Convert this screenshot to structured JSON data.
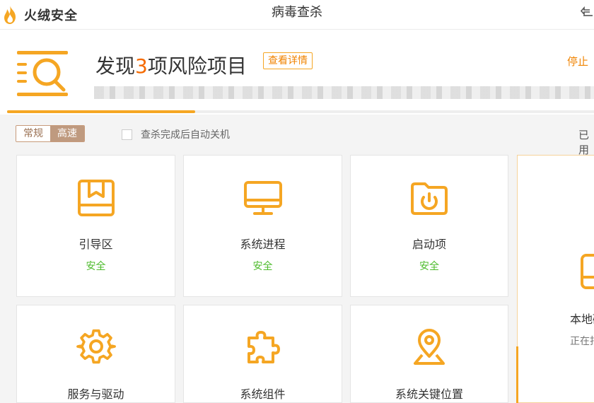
{
  "app": {
    "brand": "火绒安全",
    "window_title": "病毒查杀"
  },
  "header": {
    "title_prefix": "发现",
    "risk_count": "3",
    "title_suffix": "项风险项目",
    "details_label": "查看详情",
    "stop_label": "停止",
    "progress": 0.32
  },
  "options": {
    "mode_normal": "常规",
    "mode_fast": "高速",
    "auto_shutdown_label": "查杀完成后自动关机",
    "used_label": "已用"
  },
  "cards": [
    {
      "name": "引导区",
      "status": "安全"
    },
    {
      "name": "系统进程",
      "status": "安全"
    },
    {
      "name": "启动项",
      "status": "安全"
    },
    {
      "name": "本地磁盘",
      "status": "正在扫描"
    },
    {
      "name": "服务与驱动",
      "status": ""
    },
    {
      "name": "系统组件",
      "status": ""
    },
    {
      "name": "系统关键位置",
      "status": ""
    }
  ],
  "colors": {
    "accent": "#f5a623",
    "safe": "#4cbb2b",
    "danger": "#f56a00",
    "mode_active": "#bf9a7f"
  }
}
